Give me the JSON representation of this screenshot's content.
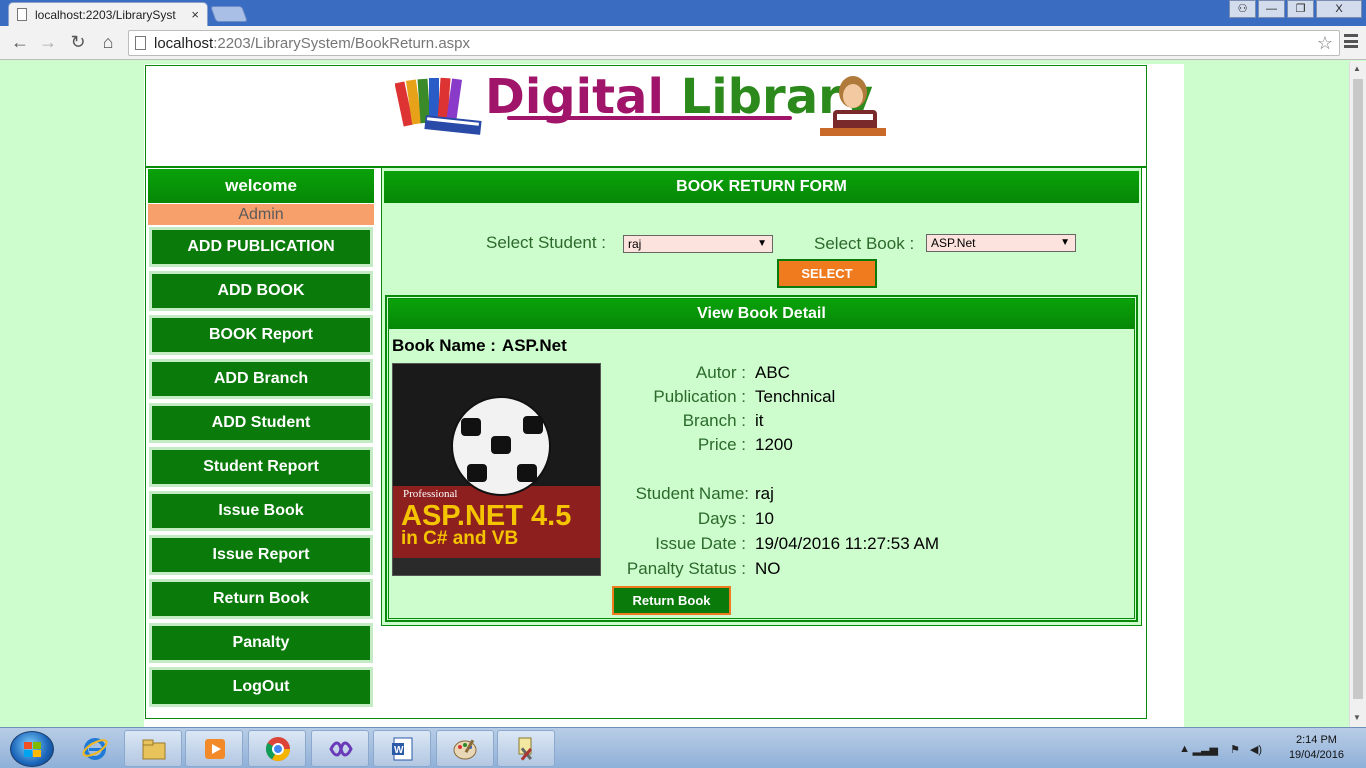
{
  "browser": {
    "tab_title": "localhost:2203/LibrarySyst",
    "tab_close": "×",
    "url_host": "localhost",
    "url_path": ":2203/LibrarySystem/BookReturn.aspx",
    "window_buttons": [
      "⚇",
      "—",
      "❐",
      "X"
    ]
  },
  "logo": {
    "part1": "Digital",
    "part2": "Library"
  },
  "sidebar": {
    "welcome": "welcome",
    "user": "Admin",
    "items": [
      "ADD PUBLICATION",
      "ADD BOOK",
      "BOOK Report",
      "ADD Branch",
      "ADD Student",
      "Student Report",
      "Issue Book",
      "Issue Report",
      "Return Book",
      "Panalty",
      "LogOut"
    ]
  },
  "form": {
    "title": "BOOK RETURN FORM",
    "student_label": "Select Student :",
    "student_value": "raj",
    "book_label": "Select Book :",
    "book_value": "ASP.Net",
    "select_button": "SELECT"
  },
  "detail": {
    "title": "View Book Detail",
    "book_name_label": "Book Name :",
    "book_name": "ASP.Net",
    "cover": {
      "kicker": "Professional",
      "title1": "ASP.NET 4.5",
      "title2": "in C# and VB"
    },
    "fields": [
      {
        "label": "Autor :",
        "value": "ABC"
      },
      {
        "label": "Publication :",
        "value": "Tenchnical"
      },
      {
        "label": "Branch :",
        "value": "it"
      },
      {
        "label": "Price :",
        "value": "1200"
      },
      {
        "label": "Student Name:",
        "value": "raj"
      },
      {
        "label": "Days :",
        "value": "10"
      },
      {
        "label": "Issue Date :",
        "value": "19/04/2016 11:27:53 AM"
      },
      {
        "label": "Panalty Status :",
        "value": "NO"
      }
    ],
    "return_button": "Return Book"
  },
  "taskbar": {
    "time": "2:14 PM",
    "date": "19/04/2016"
  },
  "colors": {
    "page_bg": "#cdfccd",
    "header_green": "#0aa20a",
    "button_green": "#0a7a0a",
    "accent_orange": "#f07a1e",
    "admin_bar": "#f8a06c",
    "logo_magenta": "#a0156a",
    "logo_green": "#2c8a1c"
  },
  "icons": [
    "page-icon",
    "back-icon",
    "forward-icon",
    "reload-icon",
    "home-icon",
    "star-icon",
    "menu-icon",
    "start-orb-icon",
    "ie-icon",
    "explorer-icon",
    "media-player-icon",
    "chrome-icon",
    "visual-studio-icon",
    "word-icon",
    "paint-icon",
    "tools-icon"
  ]
}
